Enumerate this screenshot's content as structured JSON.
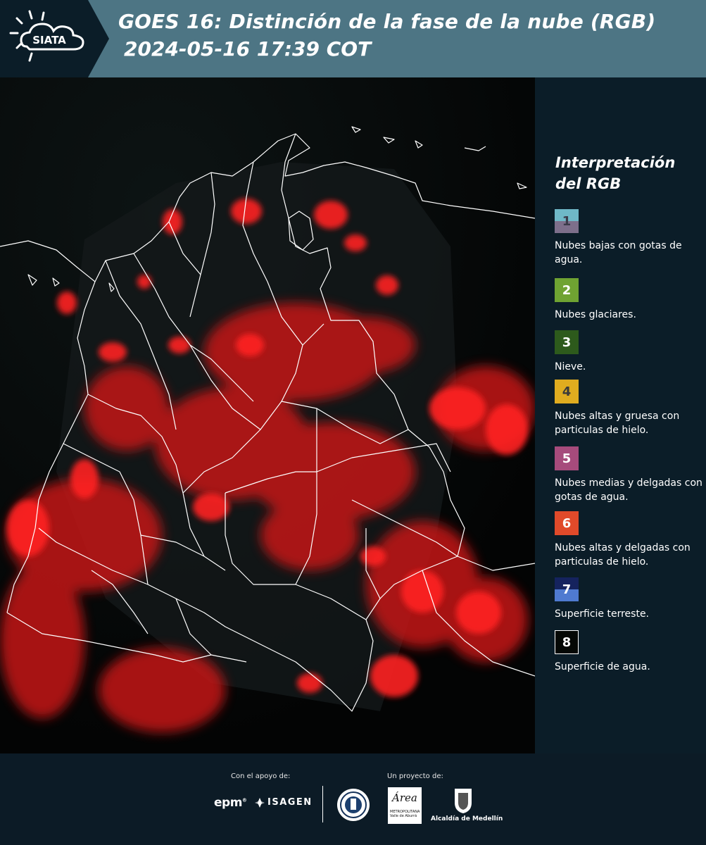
{
  "header": {
    "logo_text": "SIATA",
    "title_line1": "GOES 16: Distinción de la fase de la nube (RGB)",
    "title_line2": "2024-05-16 17:39 COT"
  },
  "map": {
    "description_icon": "colombia-map"
  },
  "legend": {
    "title": "Interpretación del RGB",
    "items": [
      {
        "number": "1",
        "label": "Nubes bajas con gotas de agua.",
        "color_top": "#6fb8c7",
        "color_bottom": "#7d6f8b",
        "num_color": "#3b3b4a"
      },
      {
        "number": "2",
        "label": "Nubes glaciares.",
        "color_top": "#6fa332",
        "color_bottom": "#6fa332",
        "num_color": "#ffffff"
      },
      {
        "number": "3",
        "label": "Nieve.",
        "color_top": "#2d5a1c",
        "color_bottom": "#2d5a1c",
        "num_color": "#ffffff"
      },
      {
        "number": "4",
        "label": "Nubes altas y gruesa con particulas de hielo.",
        "color_top": "#e0ac1f",
        "color_bottom": "#e0ac1f",
        "num_color": "#3a3a3a"
      },
      {
        "number": "5",
        "label": "Nubes medias y delgadas con gotas de agua.",
        "color_top": "#a64b7c",
        "color_bottom": "#a64b7c",
        "num_color": "#ffffff"
      },
      {
        "number": "6",
        "label": "Nubes altas y delgadas con particulas de hielo.",
        "color_top": "#e04a2a",
        "color_bottom": "#e04a2a",
        "num_color": "#ffffff"
      },
      {
        "number": "7",
        "label": "Superficie terreste.",
        "color_top": "#15235e",
        "color_bottom": "#4f7ad0",
        "num_color": "#ffffff"
      },
      {
        "number": "8",
        "label": "Superficie de agua.",
        "color_top": "#050805",
        "color_bottom": "#050805",
        "num_color": "#ffffff"
      }
    ]
  },
  "footer": {
    "support_label": "Con el apoyo de:",
    "project_label": "Un proyecto de:",
    "epm": "epm",
    "isagen": "ISAGEN",
    "area_word": "Área",
    "area_small": "METROPOLITANA Valle de Aburrá",
    "alcaldia": "Alcaldía de Medellín"
  }
}
